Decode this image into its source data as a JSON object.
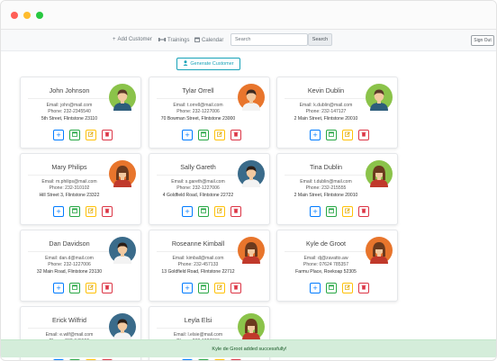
{
  "window": {
    "controls": [
      {
        "name": "close",
        "color": "#ff5f57"
      },
      {
        "name": "minimize",
        "color": "#febc2e"
      },
      {
        "name": "maximize",
        "color": "#28c840"
      }
    ]
  },
  "nav": {
    "add_customer": "Add Customer",
    "trainings": "Trainings",
    "calendar": "Calendar",
    "search_placeholder": "Search",
    "search_button": "Search",
    "signout": "Sign Out"
  },
  "generate_button": "Generate Customer",
  "customers": [
    {
      "name": "John Johnson",
      "email": "Email: john@mail.com",
      "phone": "Phone: 232-2345540",
      "address": "5th Street, Flintstone 23110",
      "avatar": {
        "bg": "#8bc34a",
        "skin": "#f2c9a0",
        "hair": "#5b3a29",
        "shirt": "#2d5d7b",
        "female": false
      }
    },
    {
      "name": "Tylar Orrell",
      "email": "Email: t.orrell@mail.com",
      "phone": "Phone: 232-1227006",
      "address": "70 Bowman Street, Flintstone 23000",
      "avatar": {
        "bg": "#e8752c",
        "skin": "#f2c9a0",
        "hair": "#3e2b20",
        "shirt": "#f3f3f3",
        "female": false
      }
    },
    {
      "name": "Kevin Dublin",
      "email": "Email: k.dublin@mail.com",
      "phone": "Phone: 232-147127",
      "address": "2 Main Street, Flintstone 20010",
      "avatar": {
        "bg": "#8bc34a",
        "skin": "#f2c9a0",
        "hair": "#5b3a29",
        "shirt": "#2d5d7b",
        "female": false
      }
    },
    {
      "name": "Mary Philips",
      "email": "Email: m.philips@mail.com",
      "phone": "Phone: 232-310102",
      "address": "Hill Street 3, Flintstone 23322",
      "avatar": {
        "bg": "#e8752c",
        "skin": "#f2c9a0",
        "hair": "#6b3a1e",
        "shirt": "#c0392b",
        "female": true
      }
    },
    {
      "name": "Sally Gareth",
      "email": "Email: s.gareth@mail.com",
      "phone": "Phone: 232-1227006",
      "address": "4 Goldfield Road, Flintstone 22722",
      "avatar": {
        "bg": "#3a6b8a",
        "skin": "#f2c9a0",
        "hair": "#2b1e16",
        "shirt": "#f3f3f3",
        "female": false
      }
    },
    {
      "name": "Tina Dublin",
      "email": "Email: t.dublin@mail.com",
      "phone": "Phone: 232-215555",
      "address": "2 Main Street, Flintstone 20010",
      "avatar": {
        "bg": "#8bc34a",
        "skin": "#f2c9a0",
        "hair": "#6b3a1e",
        "shirt": "#c0392b",
        "female": true
      }
    },
    {
      "name": "Dan Davidson",
      "email": "Email: dan.d@mail.com",
      "phone": "Phone: 232-1227006",
      "address": "32 Main Road, Flintstone 23130",
      "avatar": {
        "bg": "#3a6b8a",
        "skin": "#f2c9a0",
        "hair": "#2b1e16",
        "shirt": "#f3f3f3",
        "female": false
      }
    },
    {
      "name": "Roseanne Kimball",
      "email": "Email: kimball@mail.com",
      "phone": "Phone: 232-457133",
      "address": "13 Goldfield Road, Flintstone 22712",
      "avatar": {
        "bg": "#e8752c",
        "skin": "#f2c9a0",
        "hair": "#6b3a1e",
        "shirt": "#c0392b",
        "female": true
      }
    },
    {
      "name": "Kyle de Groot",
      "email": "Email: dj@zavatto.aw",
      "phone": "Phone: 07624 785357",
      "address": "Farmu Place, Roekoap 52305",
      "avatar": {
        "bg": "#e8752c",
        "skin": "#f2c9a0",
        "hair": "#6b3a1e",
        "shirt": "#c0392b",
        "female": true
      }
    },
    {
      "name": "Erick Wilfrid",
      "email": "Email: e.wilf@mail.com",
      "phone": "Phone: 232-345555",
      "address": "",
      "avatar": {
        "bg": "#3a6b8a",
        "skin": "#f2c9a0",
        "hair": "#2b1e16",
        "shirt": "#f3f3f3",
        "female": false
      }
    },
    {
      "name": "Leyla Elsi",
      "email": "Email: l.elsie@mail.com",
      "phone": "Phone: 232-1227006",
      "address": "",
      "avatar": {
        "bg": "#8bc34a",
        "skin": "#f2c9a0",
        "hair": "#6b3a1e",
        "shirt": "#c0392b",
        "female": true
      }
    }
  ],
  "toast": "Kyle de Groot added successfully!"
}
